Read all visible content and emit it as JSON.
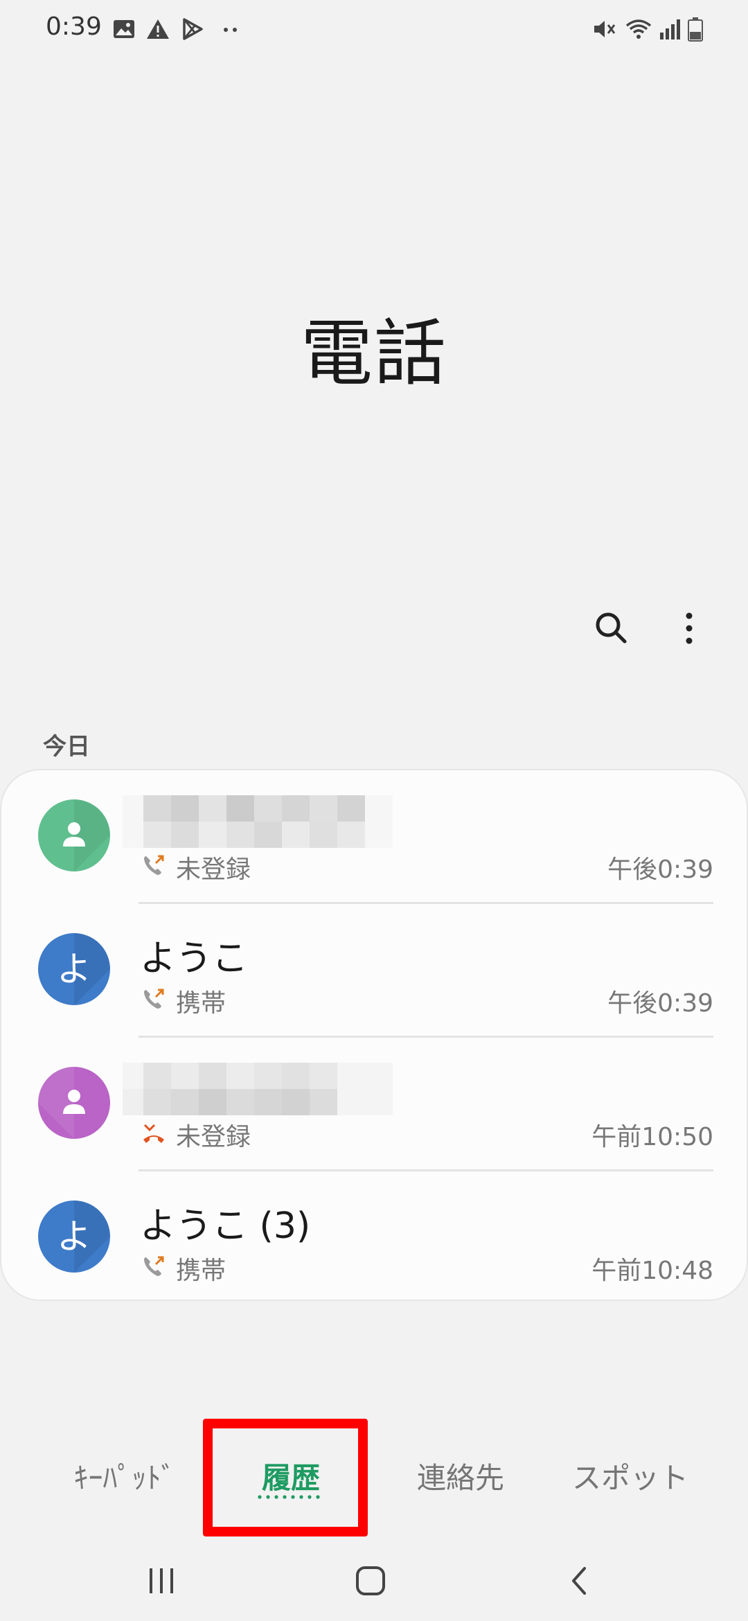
{
  "status_bar": {
    "time": "0:39",
    "left_icons": [
      "image-icon",
      "warning-icon",
      "play-store-icon",
      "more-dots-icon"
    ],
    "right_icons": [
      "mute-icon",
      "wifi-icon",
      "signal-icon",
      "battery-icon"
    ]
  },
  "header": {
    "title": "電話"
  },
  "toolbar": {
    "icons": [
      "search-icon",
      "more-options-icon"
    ]
  },
  "list": {
    "section_label": "今日",
    "calls": [
      {
        "name": "",
        "name_hidden": true,
        "number_type": "未登録",
        "time": "午後0:39",
        "call_kind": "outgoing",
        "avatar": "person-icon",
        "avatar_color": "#5fbf8e"
      },
      {
        "name": "ようこ",
        "name_hidden": false,
        "number_type": "携帯",
        "time": "午後0:39",
        "call_kind": "outgoing",
        "avatar": "よ",
        "avatar_color": "#3e7bc9"
      },
      {
        "name": "",
        "name_hidden": true,
        "number_type": "未登録",
        "time": "午前10:50",
        "call_kind": "missed",
        "avatar": "person-icon",
        "avatar_color": "#b964c6"
      },
      {
        "name": "ようこ (3)",
        "name_hidden": false,
        "number_type": "携帯",
        "time": "午前10:48",
        "call_kind": "outgoing",
        "avatar": "よ",
        "avatar_color": "#3e7bc9"
      }
    ]
  },
  "tabs": [
    {
      "label": "ｷｰﾊﾟｯﾄﾞ",
      "active": false
    },
    {
      "label": "履歴",
      "active": true
    },
    {
      "label": "連絡先",
      "active": false
    },
    {
      "label": "スポット",
      "active": false
    }
  ],
  "colors": {
    "accent": "#1e9b62",
    "missed": "#e0531f",
    "outgoing_arrow": "#e07a1f",
    "highlight": "#ff0000"
  },
  "nav_bar": {
    "icons": [
      "recent-apps-icon",
      "home-icon",
      "back-icon"
    ]
  }
}
